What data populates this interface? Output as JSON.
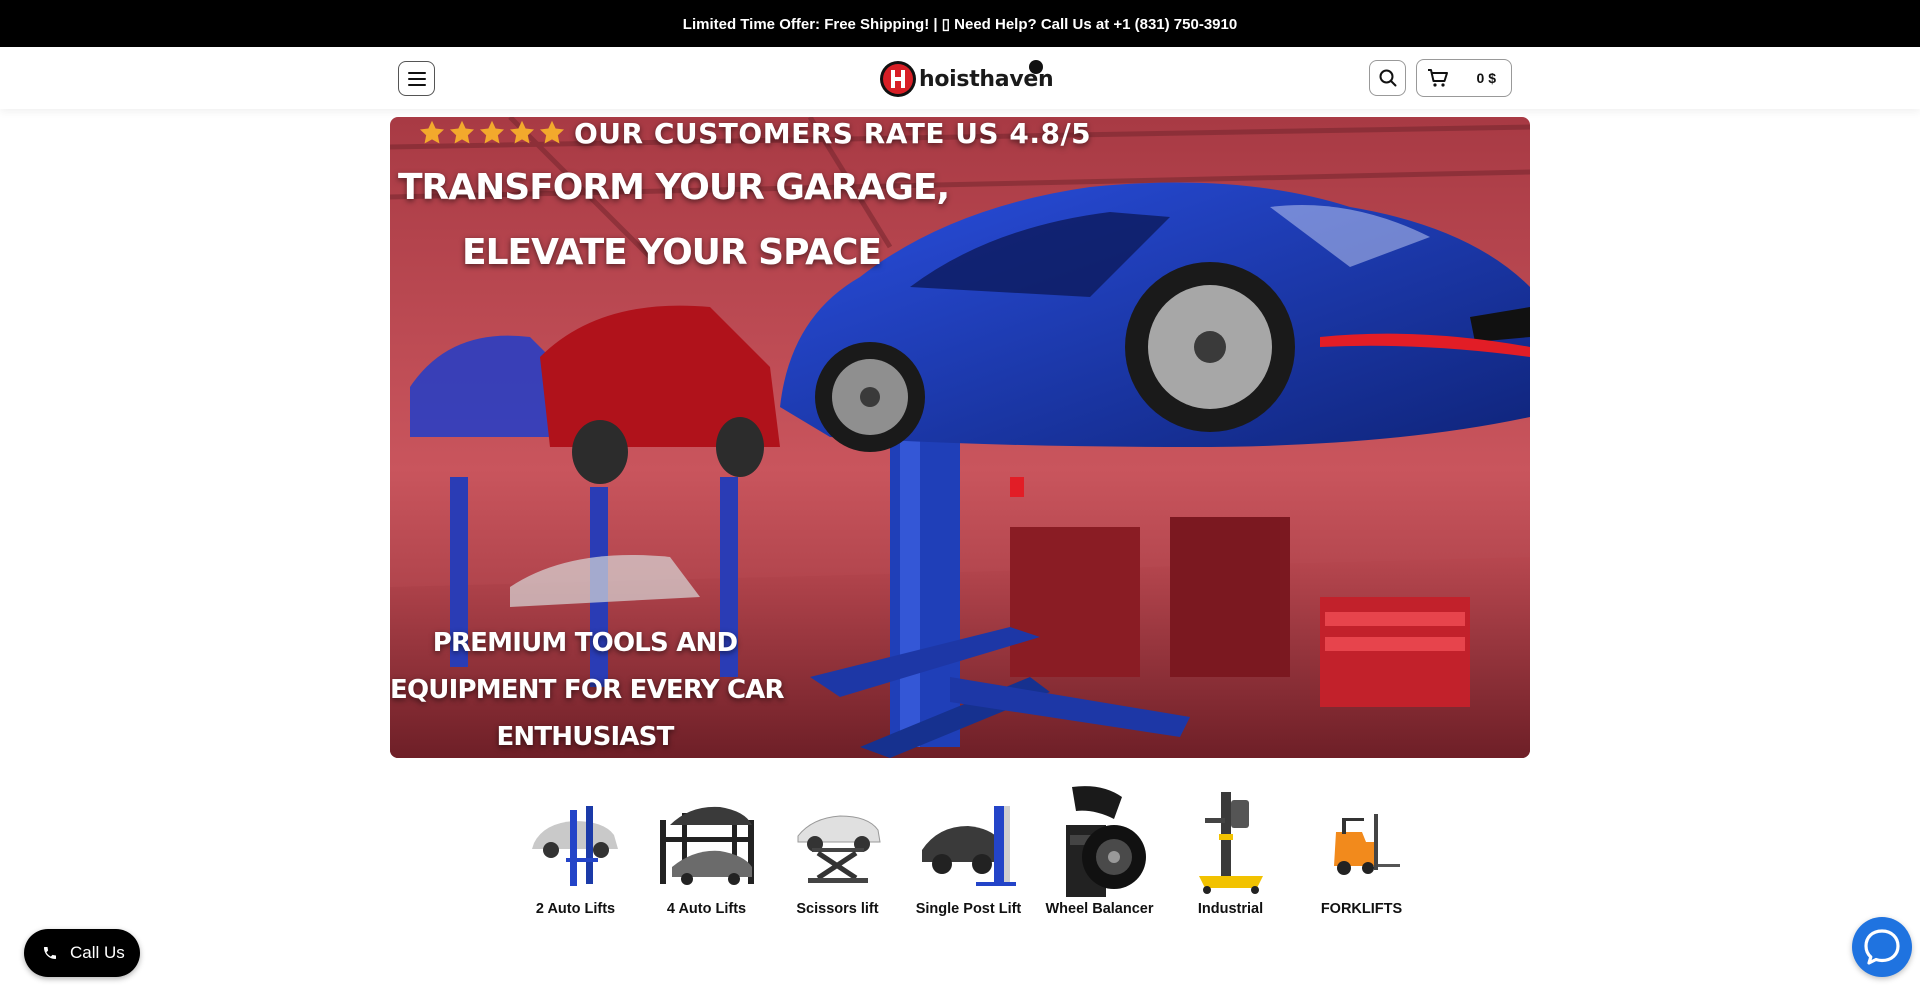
{
  "announcement": {
    "text": "Limited Time Offer: Free Shipping! | ▯ Need Help? Call Us at +1 (831) 750-3910"
  },
  "header": {
    "logo_text": "hoisthaven",
    "cart_total": "0 $"
  },
  "hero": {
    "rating_text": "OUR CUSTOMERS RATE US 4.8/5",
    "star_count": 5,
    "headline_line1": "TRANSFORM YOUR GARAGE,",
    "headline_line2": "ELEVATE YOUR SPACE",
    "sub_line1": "PREMIUM TOOLS AND",
    "sub_line2": "EQUIPMENT FOR EVERY CAR",
    "sub_line3": "ENTHUSIAST"
  },
  "categories": [
    {
      "label": "2 Auto Lifts",
      "icon": "two-post-lift-icon"
    },
    {
      "label": "4 Auto Lifts",
      "icon": "four-post-lift-icon"
    },
    {
      "label": "Scissors lift",
      "icon": "scissor-lift-icon"
    },
    {
      "label": "Single Post Lift",
      "icon": "single-post-lift-icon"
    },
    {
      "label": "Wheel Balancer",
      "icon": "wheel-balancer-icon"
    },
    {
      "label": "Industrial",
      "icon": "industrial-lift-icon"
    },
    {
      "label": "FORKLIFTS",
      "icon": "forklift-icon"
    }
  ],
  "floating": {
    "call_label": "Call Us"
  },
  "colors": {
    "topbar": "#000000",
    "brand_red": "#d81f26",
    "lift_blue": "#1f3fb8",
    "chat_blue": "#1f73e0"
  }
}
